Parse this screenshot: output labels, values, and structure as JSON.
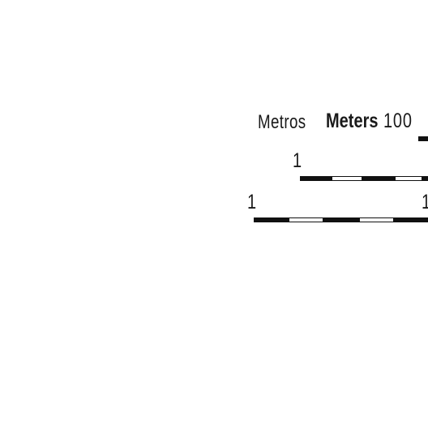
{
  "scale_bar": {
    "label_metros": "Metros",
    "label_meters": "Meters",
    "meters_tick": "100",
    "bar2_start_tick": "1",
    "bar3_start_tick": "1",
    "bar3_end_tick": "1",
    "colors": {
      "ink": "#111111",
      "background": "#ffffff"
    }
  }
}
